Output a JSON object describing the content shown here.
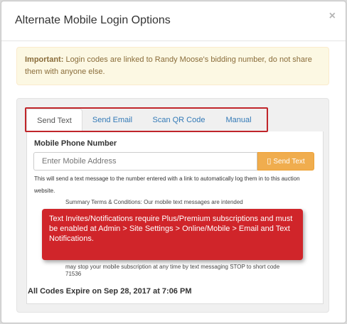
{
  "modal": {
    "title": "Alternate Mobile Login Options",
    "close_label": "×"
  },
  "alert": {
    "strong": "Important:",
    "text": " Login codes are linked to Randy Moose's bidding number, do not share them with anyone else."
  },
  "tabs": [
    {
      "label": "Send Text",
      "active": true
    },
    {
      "label": "Send Email",
      "active": false
    },
    {
      "label": "Scan QR Code",
      "active": false
    },
    {
      "label": "Manual",
      "active": false
    }
  ],
  "form": {
    "label": "Mobile Phone Number",
    "placeholder": "Enter Mobile Address",
    "button_label": "Send Text",
    "button_icon": "mobile-phone-icon",
    "help": "This will send a text message to the number entered with a link to automatically log them in to this auction website."
  },
  "terms": {
    "visible_top": "Summary Terms & Conditions: Our mobile text messages are intended",
    "visible_bottom": "may stop your mobile subscription at any time by text messaging STOP to short code 71536"
  },
  "tooltip": {
    "text": "Text Invites/Notifications require Plus/Premium subscriptions and must be enabled at Admin > Site Settings > Online/Mobile > Email and Text Notifications."
  },
  "footer": {
    "expire": "All Codes Expire on Sep 28, 2017 at 7:06 PM"
  },
  "colors": {
    "highlight": "#c0252a",
    "tooltip_bg": "#d0252a",
    "button_bg": "#f0ad4e",
    "alert_bg": "#fcf8e3",
    "alert_text": "#8a6d3b",
    "link": "#337ab7"
  }
}
